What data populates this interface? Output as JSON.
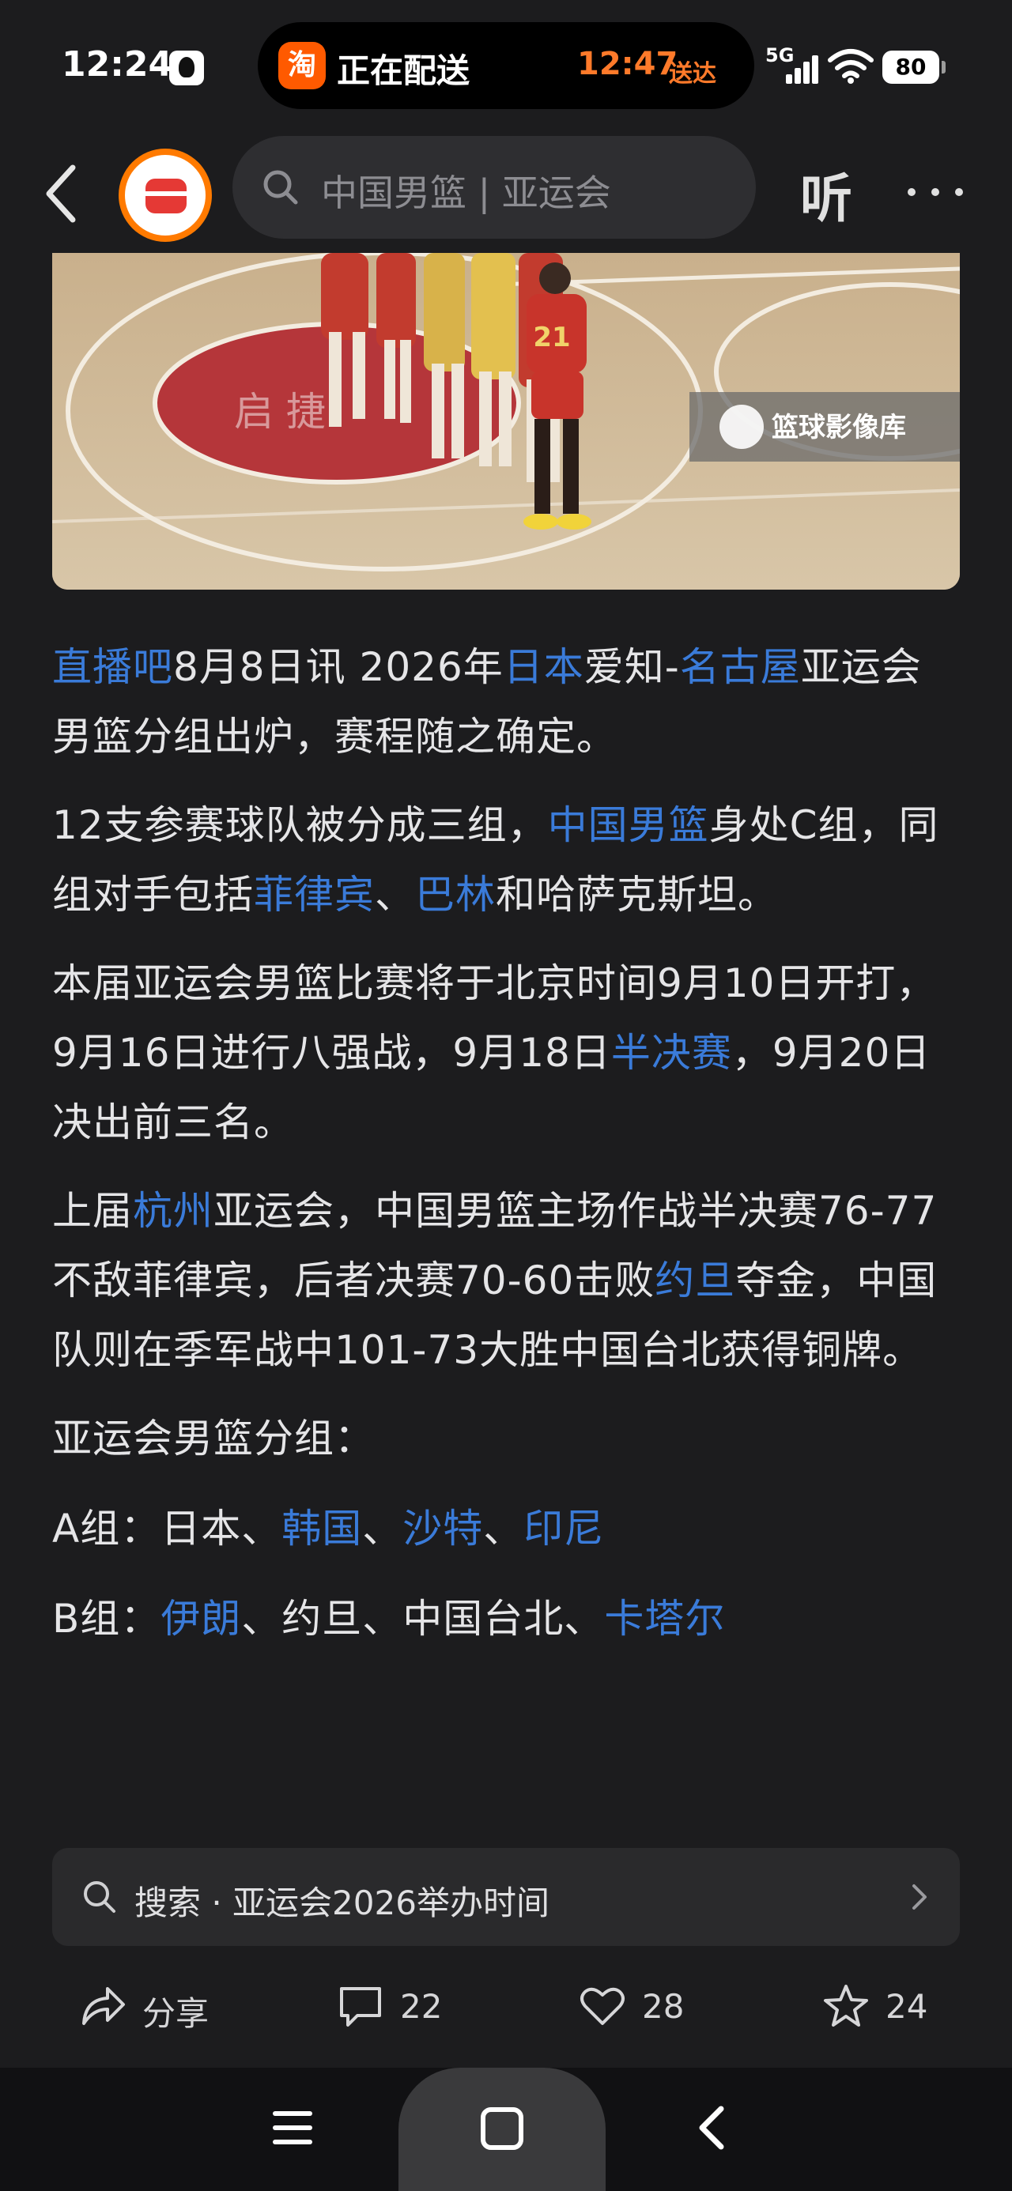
{
  "status_bar": {
    "time": "12:24",
    "island": {
      "app_icon": "淘",
      "title": "正在配送",
      "eta": "12:47",
      "eta_suffix": "送达"
    },
    "network": "5G",
    "battery": "80"
  },
  "topnav": {
    "search_placeholder": "中国男篮 | 亚运会",
    "listen_label": "听"
  },
  "hero": {
    "watermark": "篮球影像库",
    "jersey_number": "21"
  },
  "article": {
    "p1": [
      {
        "text": "直播吧",
        "link": true
      },
      {
        "text": "8月8日讯 2026年",
        "link": false
      },
      {
        "text": "日本",
        "link": true
      },
      {
        "text": "爱知-",
        "link": false
      },
      {
        "text": "名古屋",
        "link": true
      },
      {
        "text": "亚运会男篮分组出炉，赛程随之确定。",
        "link": false
      }
    ],
    "p2": [
      {
        "text": "12支参赛球队被分成三组，",
        "link": false
      },
      {
        "text": "中国男篮",
        "link": true
      },
      {
        "text": "身处C组，同组对手包括",
        "link": false
      },
      {
        "text": "菲律宾",
        "link": true
      },
      {
        "text": "、",
        "link": false
      },
      {
        "text": "巴林",
        "link": true
      },
      {
        "text": "和哈萨克斯坦。",
        "link": false
      }
    ],
    "p3": [
      {
        "text": "本届亚运会男篮比赛将于北京时间9月10日开打，9月16日进行八强战，9月18日",
        "link": false
      },
      {
        "text": "半决赛",
        "link": true
      },
      {
        "text": "，9月20日决出前三名。",
        "link": false
      }
    ],
    "p4": [
      {
        "text": "上届",
        "link": false
      },
      {
        "text": "杭州",
        "link": true
      },
      {
        "text": "亚运会，中国男篮主场作战半决赛76-77不敌菲律宾，后者决赛70-60击败",
        "link": false
      },
      {
        "text": "约旦",
        "link": true
      },
      {
        "text": "夺金，中国队则在季军战中101-73大胜中国台北获得铜牌。",
        "link": false
      }
    ],
    "p5": [
      {
        "text": "亚运会男篮分组：",
        "link": false
      }
    ],
    "group_a": [
      {
        "text": "A组：日本、",
        "link": false
      },
      {
        "text": "韩国",
        "link": true
      },
      {
        "text": "、",
        "link": false
      },
      {
        "text": "沙特",
        "link": true
      },
      {
        "text": "、",
        "link": false
      },
      {
        "text": "印尼",
        "link": true
      }
    ],
    "group_b": [
      {
        "text": "B组：",
        "link": false
      },
      {
        "text": "伊朗",
        "link": true
      },
      {
        "text": "、约旦、中国台北、",
        "link": false
      },
      {
        "text": "卡塔尔",
        "link": true
      }
    ]
  },
  "related_search": {
    "text": "搜索 · 亚运会2026举办时间"
  },
  "actions": {
    "share_label": "分享",
    "comments_count": "22",
    "likes_count": "28",
    "favorites_count": "24"
  },
  "colors": {
    "link": "#3a7bd9",
    "background": "#1c1c1e",
    "island_accent": "#ff7a2a"
  }
}
